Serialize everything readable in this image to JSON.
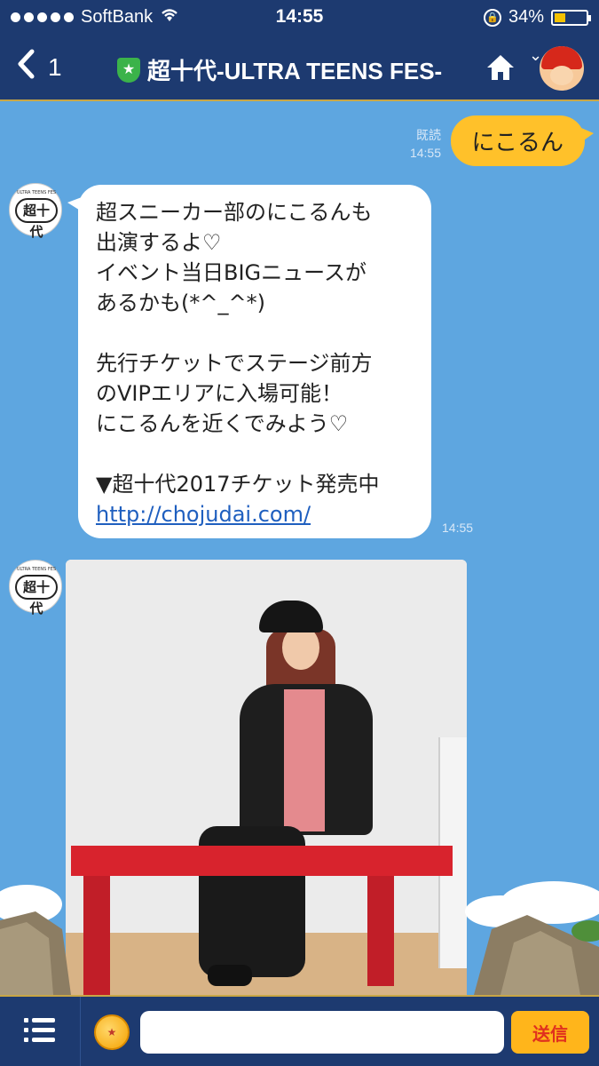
{
  "status_bar": {
    "carrier": "SoftBank",
    "time": "14:55",
    "battery": "34%"
  },
  "header": {
    "unread_count": "1",
    "title": "超十代-ULTRA TEENS FES-"
  },
  "messages": {
    "outgoing": {
      "read_label": "既読",
      "time": "14:55",
      "text": "にこるん"
    },
    "incoming_text": {
      "lines": [
        "超スニーカー部のにこるんも",
        "出演するよ♡",
        "イベント当日BIGニュースが",
        "あるかも(*^_^*)",
        "",
        "先行チケットでステージ前方",
        "のVIPエリアに入場可能！",
        "にこるんを近くでみよう♡",
        "",
        "▼超十代2017チケット発売中"
      ],
      "link": "http://chojudai.com/",
      "time": "14:55"
    },
    "sender_logo_text": "超十代",
    "sender_logo_small": "ULTRA TEENS FES"
  },
  "input_bar": {
    "placeholder": "",
    "send_label": "送信"
  },
  "colors": {
    "header_bg": "#1d3a70",
    "chat_bg": "#5ea6e0",
    "outgoing_bubble": "#ffc12a",
    "send_button": "#ffb51b"
  }
}
